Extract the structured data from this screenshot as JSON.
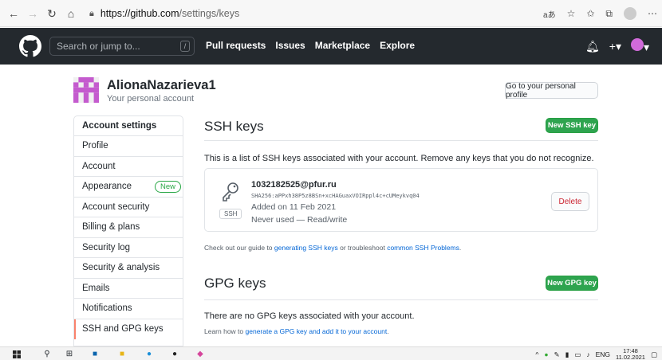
{
  "browser": {
    "url_host": "https://github.com",
    "url_path": "/settings/keys",
    "reader_glyph": "aあ"
  },
  "header": {
    "search_placeholder": "Search or jump to...",
    "search_key": "/",
    "nav": [
      "Pull requests",
      "Issues",
      "Marketplace",
      "Explore"
    ]
  },
  "profile": {
    "name": "AlionaNazarieva1",
    "subtitle": "Your personal account",
    "profile_button": "Go to your personal profile"
  },
  "sidebar": {
    "title": "Account settings",
    "items": [
      {
        "label": "Profile"
      },
      {
        "label": "Account"
      },
      {
        "label": "Appearance",
        "badge": "New"
      },
      {
        "label": "Account security"
      },
      {
        "label": "Billing & plans"
      },
      {
        "label": "Security log"
      },
      {
        "label": "Security & analysis"
      },
      {
        "label": "Emails"
      },
      {
        "label": "Notifications"
      },
      {
        "label": "SSH and GPG keys"
      }
    ]
  },
  "ssh": {
    "heading": "SSH keys",
    "new_button": "New SSH key",
    "description": "This is a list of SSH keys associated with your account. Remove any keys that you do not recognize.",
    "key": {
      "title": "1032182525@pfur.ru",
      "fingerprint": "SHA256:aPPxh38P5z8BSn+xcHAGuaxVOIRppl4c+cUMeykvq04",
      "added": "Added on 11 Feb 2021",
      "usage": "Never used — Read/write",
      "type_label": "SSH",
      "delete_button": "Delete"
    },
    "guide_prefix": "Check out our guide to ",
    "guide_link1": "generating SSH keys",
    "guide_middle": " or troubleshoot ",
    "guide_link2": "common SSH Problems",
    "guide_suffix": "."
  },
  "gpg": {
    "heading": "GPG keys",
    "new_button": "New GPG key",
    "empty_text": "There are no GPG keys associated with your account.",
    "learn_prefix": "Learn how to ",
    "learn_link": "generate a GPG key and add it to your account",
    "learn_suffix": "."
  },
  "taskbar": {
    "language": "ENG",
    "time": "17:48",
    "date": "11.02.2021"
  },
  "colors": {
    "header_bg": "#24292e",
    "green": "#2ea44f",
    "link": "#0366d6",
    "active_marker": "#f9826c",
    "danger": "#cb2431"
  }
}
